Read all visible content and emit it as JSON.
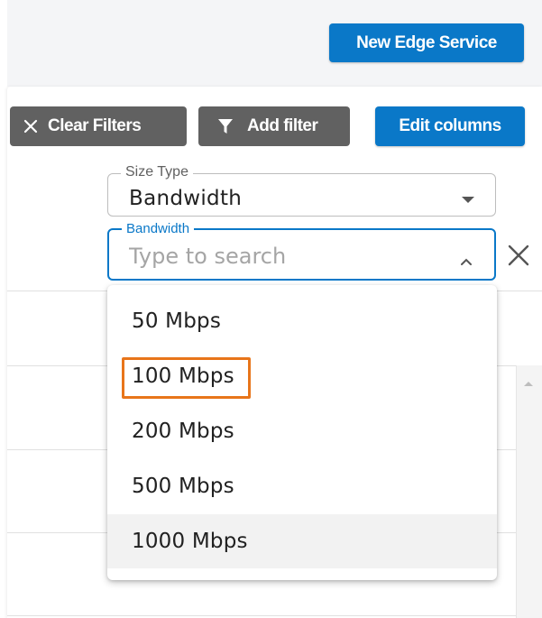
{
  "header": {
    "new_service_label": "New Edge Service"
  },
  "toolbar": {
    "clear_filters_label": "Clear Filters",
    "add_filter_label": "Add filter",
    "edit_columns_label": "Edit columns"
  },
  "filters": {
    "size_type": {
      "legend": "Size Type",
      "value": "Bandwidth"
    },
    "bandwidth": {
      "legend": "Bandwidth",
      "placeholder": "Type to search"
    }
  },
  "dropdown": {
    "options": [
      {
        "label": "50 Mbps"
      },
      {
        "label": "100 Mbps",
        "focused": true
      },
      {
        "label": "200 Mbps"
      },
      {
        "label": "500 Mbps"
      },
      {
        "label": "1000 Mbps",
        "hovered": true
      }
    ]
  },
  "colors": {
    "primary": "#0a78c8",
    "secondary_button": "#616161",
    "focus_outline": "#e8751a"
  }
}
